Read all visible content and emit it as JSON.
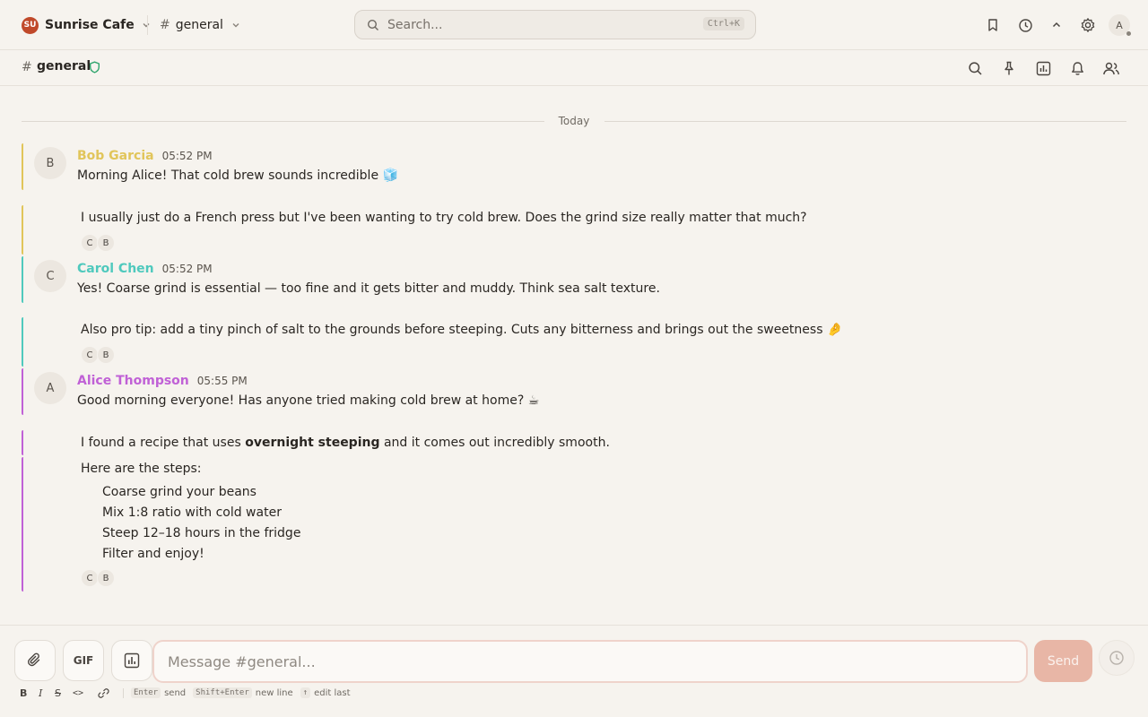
{
  "workspace": {
    "initials": "SU",
    "name": "Sunrise Cafe",
    "color": "#c0492a"
  },
  "channel_selector": {
    "hash": "#",
    "name": "general"
  },
  "search": {
    "placeholder": "Search...",
    "shortcut": "Ctrl+K"
  },
  "top_icons": [
    "bookmark-icon",
    "history-icon",
    "chevron-up-icon",
    "gear-icon"
  ],
  "user": {
    "initial": "A"
  },
  "channel": {
    "hash": "#",
    "name": "general"
  },
  "channel_icons": [
    "search-icon",
    "pin-icon",
    "poll-icon",
    "bell-icon",
    "members-icon"
  ],
  "day_divider": "Today",
  "messages": [
    {
      "author": "Bob Garcia",
      "initial": "B",
      "time": "05:52 PM",
      "color": "#e1c55a",
      "text": "Morning Alice! That cold brew sounds incredible 🧊",
      "followup": "I usually just do a French press but I've been wanting to try cold brew. Does the grind size really matter that much?",
      "readers": [
        "C",
        "B"
      ]
    },
    {
      "author": "Carol Chen",
      "initial": "C",
      "time": "05:52 PM",
      "color": "#4fc9bd",
      "text": "Yes! Coarse grind is essential — too fine and it gets bitter and muddy. Think sea salt texture.",
      "followup": "Also pro tip: add a tiny pinch of salt to the grounds before steeping. Cuts any bitterness and brings out the sweetness 🤌",
      "readers": [
        "C",
        "B"
      ]
    },
    {
      "author": "Alice Thompson",
      "initial": "A",
      "time": "05:55 PM",
      "color": "#c061d6",
      "text": "Good morning everyone! Has anyone tried making cold brew at home? ☕",
      "followup_pre": "I found a recipe that uses ",
      "followup_bold": "overnight steeping",
      "followup_post": " and it comes out incredibly smooth.",
      "steps_intro": "Here are the steps:",
      "steps": [
        "Coarse grind your beans",
        "Mix 1:8 ratio with cold water",
        "Steep 12–18 hours in the fridge",
        "Filter and enjoy!"
      ],
      "readers": [
        "C",
        "B"
      ]
    }
  ],
  "composer": {
    "gif_label": "GIF",
    "placeholder": "Message #general...",
    "send_label": "Send",
    "format_buttons": [
      "B",
      "I",
      "S",
      "<>"
    ],
    "hints": [
      {
        "key": "Enter",
        "text": "send"
      },
      {
        "key": "Shift+Enter",
        "text": "new line"
      },
      {
        "key": "↑",
        "text": "edit last"
      }
    ]
  }
}
